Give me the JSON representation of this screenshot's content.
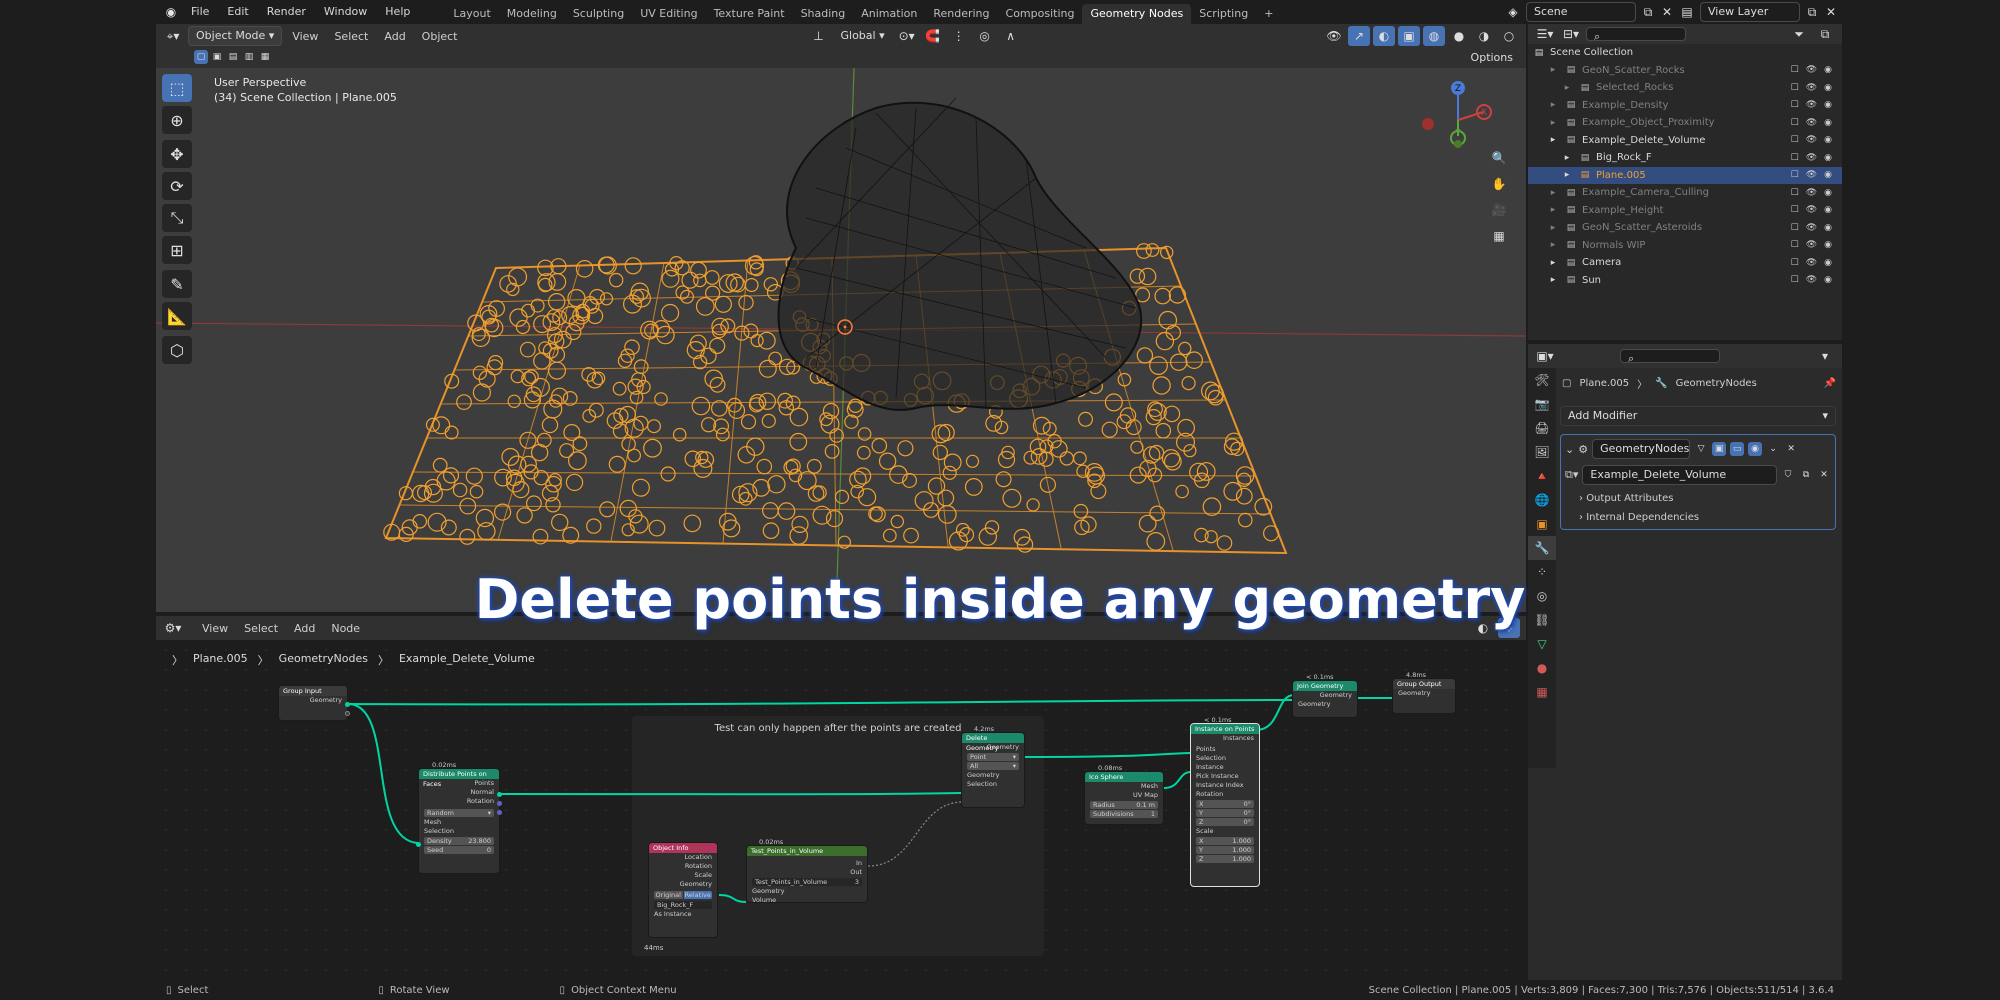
{
  "topbar": {
    "menus": [
      "File",
      "Edit",
      "Render",
      "Window",
      "Help"
    ],
    "workspaces": [
      "Layout",
      "Modeling",
      "Sculpting",
      "UV Editing",
      "Texture Paint",
      "Shading",
      "Animation",
      "Rendering",
      "Compositing",
      "Geometry Nodes",
      "Scripting"
    ],
    "active_workspace": "Geometry Nodes",
    "add_tab": "+",
    "scene": "Scene",
    "view_layer": "View Layer"
  },
  "viewport_header": {
    "mode": "Object Mode",
    "menus": [
      "View",
      "Select",
      "Add",
      "Object"
    ],
    "transform_orientation": "Global",
    "options": "Options"
  },
  "viewport": {
    "perspective": "User Perspective",
    "collection_info": "(34) Scene Collection | Plane.005",
    "gizmo": {
      "z": "Z",
      "y": "Y",
      "x": "X"
    }
  },
  "overlay_title": "Delete points inside any geometry",
  "node_editor": {
    "menus": [
      "View",
      "Select",
      "Add",
      "Node"
    ],
    "breadcrumb": [
      "Plane.005",
      "GeometryNodes",
      "Example_Delete_Volume"
    ],
    "frame_label": "Test can only happen after the points are created",
    "timing_bottom": "44ms",
    "nodes": {
      "group_input": {
        "title": "Group Input",
        "out": "Geometry"
      },
      "distribute": {
        "time": "0.02ms",
        "title": "Distribute Points on Faces",
        "outputs": [
          "Points",
          "Normal",
          "Rotation"
        ],
        "mode": "Random",
        "inputs": [
          "Mesh",
          "Selection"
        ],
        "density_label": "Density",
        "density": "23.800",
        "seed_label": "Seed",
        "seed": "0"
      },
      "object_info": {
        "title": "Object Info",
        "outputs": [
          "Location",
          "Rotation",
          "Scale",
          "Geometry"
        ],
        "modes": [
          "Original",
          "Relative"
        ],
        "object": "Big_Rock_F",
        "as_instance": "As Instance"
      },
      "test_points": {
        "time": "0.02ms",
        "title": "Test_Points_in_Volume",
        "outputs": [
          "In",
          "Out"
        ],
        "group": "Test_Points_in_Volume",
        "users": "3",
        "inputs": [
          "Geometry",
          "Volume"
        ]
      },
      "delete": {
        "time": "4.2ms",
        "title": "Delete Geometry",
        "out": "Geometry",
        "domain": "Point",
        "mode": "All",
        "inputs": [
          "Geometry",
          "Selection"
        ]
      },
      "ico": {
        "time": "0.08ms",
        "title": "Ico Sphere",
        "outputs": [
          "Mesh",
          "UV Map"
        ],
        "radius_label": "Radius",
        "radius": "0.1 m",
        "subdiv_label": "Subdivisions",
        "subdiv": "1"
      },
      "instance": {
        "time": "< 0.1ms",
        "title": "Instance on Points",
        "out": "Instances",
        "inputs": [
          "Points",
          "Selection",
          "Instance",
          "Pick Instance",
          "Instance Index",
          "Rotation"
        ],
        "rot": [
          [
            "X",
            "0°"
          ],
          [
            "Y",
            "0°"
          ],
          [
            "Z",
            "0°"
          ]
        ],
        "scale_label": "Scale",
        "scale": [
          [
            "X",
            "1.000"
          ],
          [
            "Y",
            "1.000"
          ],
          [
            "Z",
            "1.000"
          ]
        ]
      },
      "join": {
        "time": "< 0.1ms",
        "title": "Join Geometry",
        "out": "Geometry",
        "in": "Geometry"
      },
      "group_output": {
        "time": "4.8ms",
        "title": "Group Output",
        "in": "Geometry"
      }
    }
  },
  "outliner": {
    "root": "Scene Collection",
    "items": [
      {
        "label": "GeoN_Scatter_Rocks",
        "indent": 1,
        "dim": true
      },
      {
        "label": "Selected_Rocks",
        "indent": 2,
        "dim": true
      },
      {
        "label": "Example_Density",
        "indent": 1,
        "dim": true
      },
      {
        "label": "Example_Object_Proximity",
        "indent": 1,
        "dim": true
      },
      {
        "label": "Example_Delete_Volume",
        "indent": 1,
        "dim": false
      },
      {
        "label": "Big_Rock_F",
        "indent": 2,
        "dim": false
      },
      {
        "label": "Plane.005",
        "indent": 2,
        "dim": false,
        "selected": true
      },
      {
        "label": "Example_Camera_Culling",
        "indent": 1,
        "dim": true
      },
      {
        "label": "Example_Height",
        "indent": 1,
        "dim": true
      },
      {
        "label": "GeoN_Scatter_Asteroids",
        "indent": 1,
        "dim": true
      },
      {
        "label": "Normals WIP",
        "indent": 1,
        "dim": true
      },
      {
        "label": "Camera",
        "indent": 1,
        "dim": false
      },
      {
        "label": "Sun",
        "indent": 1,
        "dim": false
      }
    ]
  },
  "properties": {
    "object": "Plane.005",
    "modifier_path": "GeometryNodes",
    "add_modifier": "Add Modifier",
    "modifier_name": "GeometryNodes",
    "node_group": "Example_Delete_Volume",
    "panels": [
      "Output Attributes",
      "Internal Dependencies"
    ]
  },
  "statusbar": {
    "left": [
      "Select",
      "Rotate View",
      "Object Context Menu"
    ],
    "right": "Scene Collection | Plane.005 | Verts:3,809 | Faces:7,300 | Tris:7,576 | Objects:511/514 | 3.6.4"
  },
  "colors": {
    "accent": "#4772b3",
    "selection": "#f0a030",
    "node_geo": "#1a8a6a",
    "node_input": "#b0335a",
    "node_group": "#3b6e2a"
  }
}
